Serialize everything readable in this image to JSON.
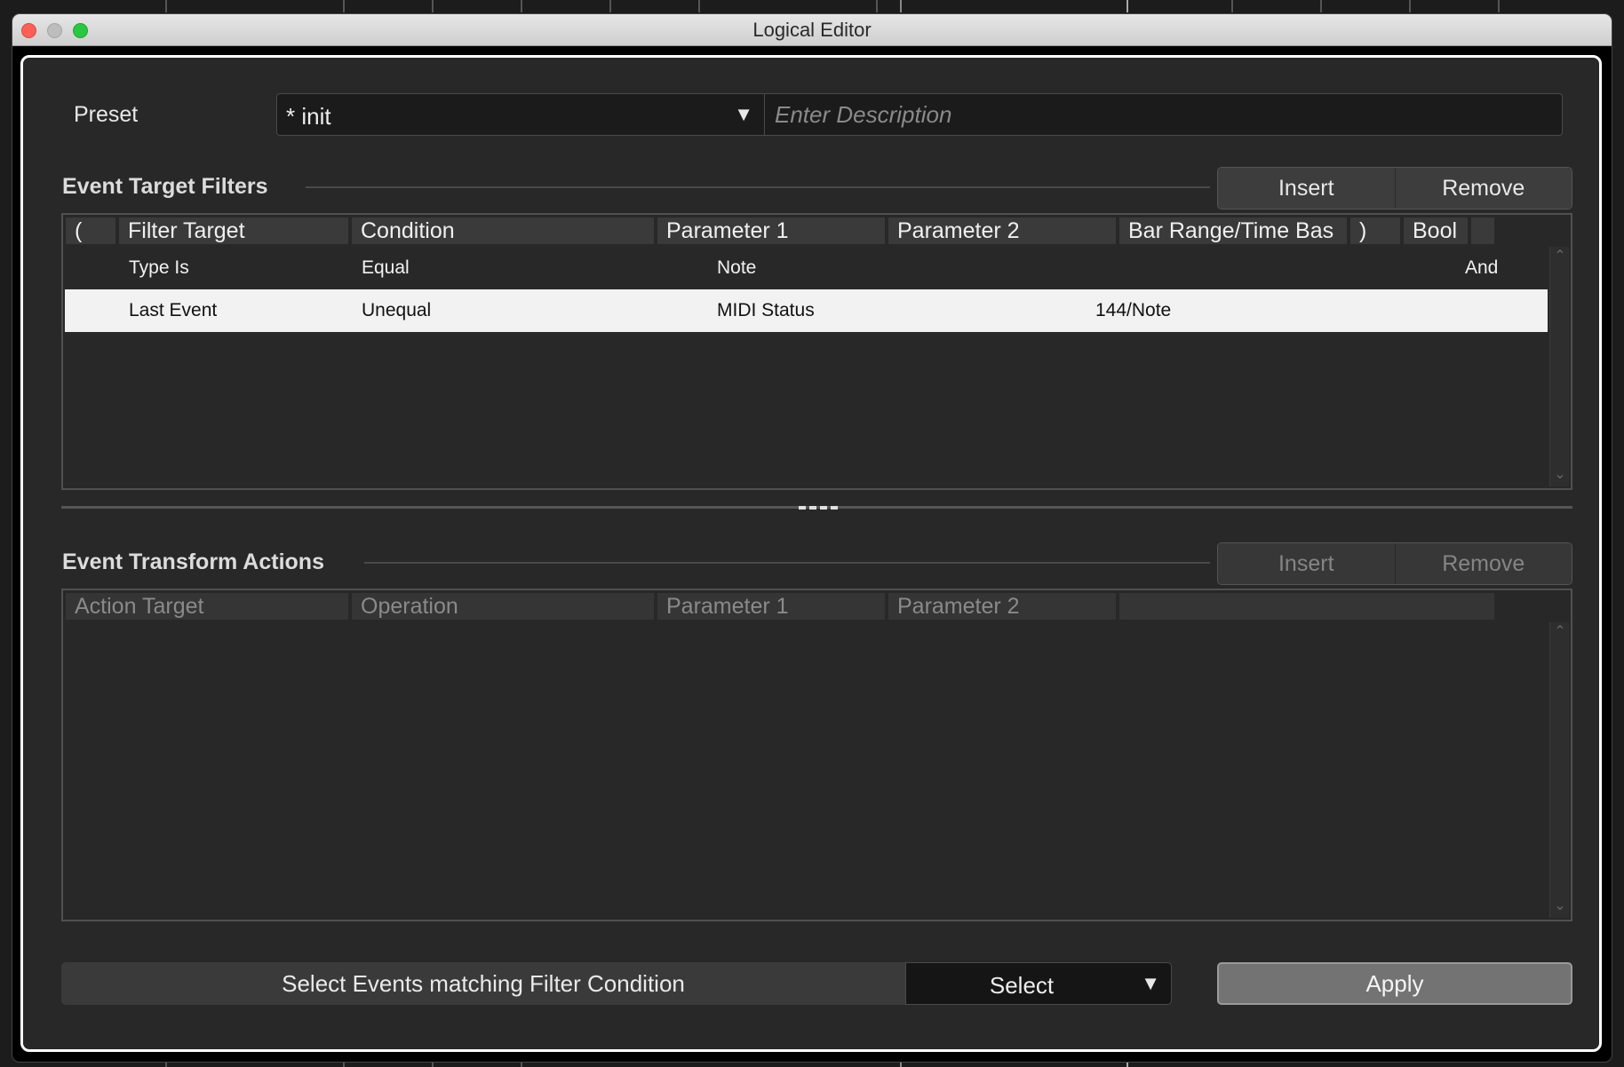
{
  "window": {
    "title": "Logical Editor"
  },
  "preset": {
    "label": "Preset",
    "selected": "* init",
    "arrow": "▼",
    "description_placeholder": "Enter Description"
  },
  "filters": {
    "title": "Event Target Filters",
    "insert_label": "Insert",
    "remove_label": "Remove",
    "columns": [
      "(",
      "Filter Target",
      "Condition",
      "Parameter 1",
      "Parameter 2",
      "Bar Range/Time Bas",
      ")",
      "Bool"
    ],
    "rows": [
      {
        "open": "",
        "target": "Type Is",
        "condition": "Equal",
        "param1": "Note",
        "param2": "",
        "range": "",
        "close": "",
        "bool": "And",
        "selected": false
      },
      {
        "open": "",
        "target": "Last Event",
        "condition": "Unequal",
        "param1": "MIDI Status",
        "param2": "144/Note",
        "range": "",
        "close": "",
        "bool": "",
        "selected": true
      }
    ]
  },
  "actions": {
    "title": "Event Transform Actions",
    "insert_label": "Insert",
    "remove_label": "Remove",
    "columns": [
      "Action Target",
      "Operation",
      "Parameter 1",
      "Parameter 2",
      ""
    ]
  },
  "footer": {
    "function_label": "Select Events matching Filter Condition",
    "mode_selected": "Select",
    "mode_arrow": "▼",
    "apply_label": "Apply"
  },
  "colors": {
    "panel_bg": "#282828",
    "selected_row_bg": "#f2f2f2",
    "close": "#fe5f57",
    "maximize": "#28c840"
  }
}
